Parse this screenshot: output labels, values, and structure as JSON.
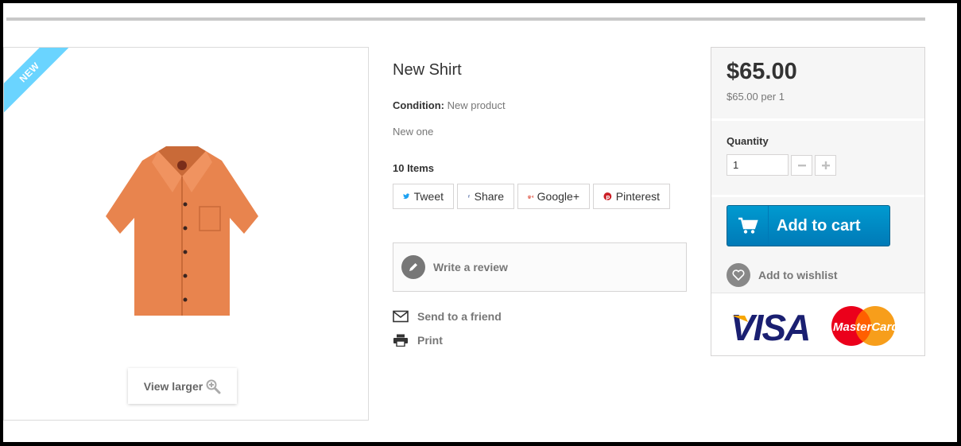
{
  "product": {
    "badge": "NEW",
    "title": "New Shirt",
    "condition_label": "Condition:",
    "condition_value": "New product",
    "short_description": "New one",
    "items_count": "10 Items",
    "view_larger": "View larger"
  },
  "social": {
    "tweet": "Tweet",
    "share": "Share",
    "google": "Google+",
    "pinterest": "Pinterest"
  },
  "actions": {
    "write_review": "Write a review",
    "send_to_friend": "Send to a friend",
    "print": "Print"
  },
  "buy_box": {
    "price": "$65.00",
    "unit_price": "$65.00 per 1",
    "quantity_label": "Quantity",
    "quantity_value": "1",
    "add_to_cart": "Add to cart",
    "add_to_wishlist": "Add to wishlist",
    "cards": {
      "visa": "VISA",
      "mastercard": "MasterCard"
    }
  },
  "colors": {
    "ribbon": "#6ad4ff",
    "add_to_cart": "#0089c6",
    "shirt": "#e8844e"
  },
  "icons": [
    "twitter-icon",
    "facebook-icon",
    "google-plus-icon",
    "pinterest-icon",
    "pencil-icon",
    "envelope-icon",
    "printer-icon",
    "cart-icon",
    "heart-icon",
    "zoom-icon"
  ]
}
